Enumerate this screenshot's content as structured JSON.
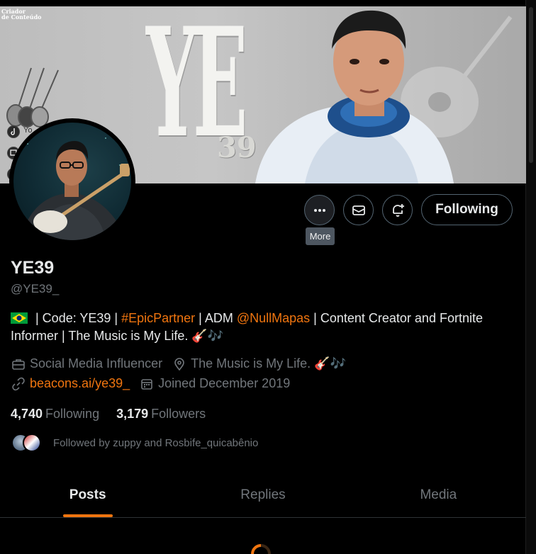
{
  "banner": {
    "creator_line1": "Criador",
    "creator_line2": "de Conteúdo",
    "big_text": "YE",
    "small_text": "39",
    "social_label": "Yo"
  },
  "actions": {
    "more_tooltip": "More",
    "following_label": "Following",
    "more_icon": "ellipsis-icon",
    "message_icon": "envelope-icon",
    "notify_icon": "bell-plus-icon"
  },
  "profile": {
    "display_name": "YE39",
    "handle": "@YE39_",
    "bio": {
      "flag": "brazil-flag-emoji",
      "part1": " | Code: YE39 | ",
      "hashtag": "#EpicPartner",
      "part2": " | ADM ",
      "mention": "@NullMapas",
      "part3": " | Content Creator and Fortnite Informer | The Music is My Life. ",
      "emoji": "🎸🎶"
    },
    "category": "Social Media Influencer",
    "location": "The Music is My Life. 🎸🎶",
    "link": "beacons.ai/ye39_",
    "joined": "Joined December 2019"
  },
  "stats": {
    "following_count": "4,740",
    "following_label": "Following",
    "followers_count": "3,179",
    "followers_label": "Followers"
  },
  "followed_by": "Followed by zuppy and Rosbife_quicabênio",
  "tabs": [
    {
      "label": "Posts",
      "active": true
    },
    {
      "label": "Replies",
      "active": false
    },
    {
      "label": "Media",
      "active": false
    }
  ],
  "colors": {
    "accent": "#f0750f",
    "secondary_text": "#71767b",
    "primary_text": "#e7e9ea",
    "background": "#000000"
  }
}
